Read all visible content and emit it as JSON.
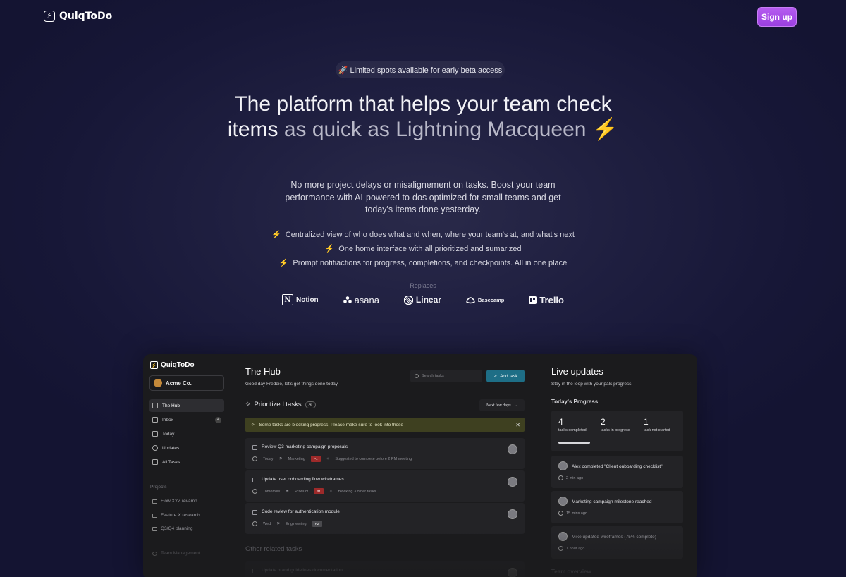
{
  "header": {
    "logo_text": "QuiqToDo",
    "signup_label": "Sign up"
  },
  "hero": {
    "beta_badge": "🚀 Limited spots available for early beta access",
    "headline_part1": "The platform that helps your team check items ",
    "headline_part2": "as quick as Lightning Macqueen",
    "headline_emoji": "⚡",
    "subtitle": "No more project delays or misalignement on tasks. Boost your team performance with AI-powered to-dos optimized for small teams and get today's items done yesterday.",
    "features": [
      "Centralized view of who does what and when, where your team's at, and what's next",
      "One home interface with all prioritized and sumarized",
      "Prompt notifiactions for progress, completions, and checkpoints. All in one place"
    ],
    "replaces_label": "Replaces",
    "brands": [
      "Notion",
      "asana",
      "Linear",
      "Basecamp",
      "Trello"
    ]
  },
  "app": {
    "logo_text": "QuiqToDo",
    "workspace": "Acme Co.",
    "nav": [
      {
        "label": "The Hub"
      },
      {
        "label": "Inbox",
        "count": "4"
      },
      {
        "label": "Today"
      },
      {
        "label": "Updates"
      },
      {
        "label": "All Tasks"
      }
    ],
    "projects_label": "Projects",
    "projects_add": "+",
    "projects": [
      "Flow XYZ revamp",
      "Feature X research",
      "Q3/Q4 planning"
    ],
    "team_management": "Team Management",
    "hub": {
      "title": "The Hub",
      "greeting": "Good day Freddie, let's get things done today",
      "search_placeholder": "Search tasks",
      "add_task": "Add task",
      "prioritized_title": "Prioritized tasks",
      "ai_badge": "AI",
      "next_days": "Next few days",
      "alert": "Some tasks are blocking progress. Please make sure to look into those",
      "tasks": [
        {
          "title": "Review Q3 marketing campaign proposals",
          "due": "Today",
          "tag": "Marketing",
          "priority": "P1",
          "note": "Suggested to complete before 2 PM meeting"
        },
        {
          "title": "Update user onboarding flow wireframes",
          "due": "Tomorrow",
          "tag": "Product",
          "priority": "P1",
          "note": "Blocking 3 other tasks"
        },
        {
          "title": "Code review for authentication module",
          "due": "Wed",
          "tag": "Engineering",
          "priority": "P2",
          "note": ""
        }
      ],
      "other_title": "Other related tasks",
      "other_tasks": [
        {
          "title": "Update brand guidelines documentation"
        }
      ]
    },
    "live": {
      "title": "Live updates",
      "subtitle": "Stay in the loop with your pals progress",
      "progress_title": "Today's Progress",
      "stats": [
        {
          "n": "4",
          "label": "tasks completed"
        },
        {
          "n": "2",
          "label": "tasks in progress"
        },
        {
          "n": "1",
          "label": "task not started"
        }
      ],
      "completion_fraction": 0.27,
      "updates": [
        {
          "text": "Alex completed \"Client onboarding checklist\"",
          "time": "2 min ago"
        },
        {
          "text": "Marketing campaign milestone reached",
          "time": "15 mins ago"
        },
        {
          "text": "Mike updated wireframes (75% complete)",
          "time": "1 hour ago"
        }
      ],
      "team_overview": "Team overview"
    }
  }
}
